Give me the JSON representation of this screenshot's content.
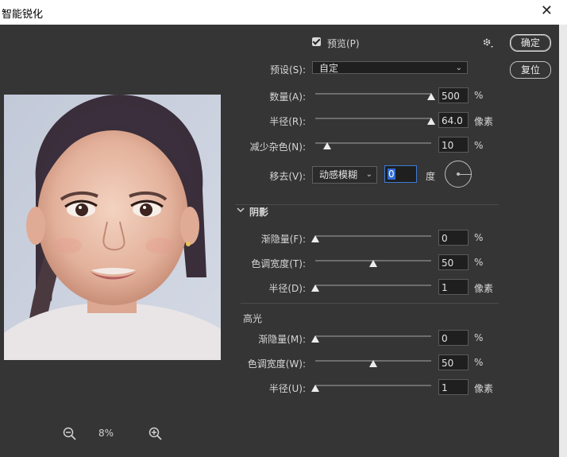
{
  "window": {
    "title": "智能锐化"
  },
  "header": {
    "preview_label": "预览(P)",
    "preview_checked": true
  },
  "buttons": {
    "ok": "确定",
    "reset": "复位"
  },
  "preset": {
    "label": "预设(S):",
    "value": "自定"
  },
  "main": {
    "amount": {
      "label": "数量(A):",
      "value": "500",
      "unit": "%",
      "level": 1.0
    },
    "radius": {
      "label": "半径(R):",
      "value": "64.0",
      "unit": "像素",
      "level": 1.0
    },
    "noise": {
      "label": "减少杂色(N):",
      "value": "10",
      "unit": "%",
      "level": 0.1
    },
    "remove": {
      "label": "移去(V):",
      "value": "动感模糊",
      "angle": "0",
      "angle_unit": "度"
    }
  },
  "shadow": {
    "title": "阴影",
    "fade": {
      "label": "渐隐量(F):",
      "value": "0",
      "unit": "%",
      "level": 0.0
    },
    "tonal_width": {
      "label": "色调宽度(T):",
      "value": "50",
      "unit": "%",
      "level": 0.5
    },
    "radius": {
      "label": "半径(D):",
      "value": "1",
      "unit": "像素",
      "level": 0.0
    }
  },
  "highlight": {
    "title": "高光",
    "fade": {
      "label": "渐隐量(M):",
      "value": "0",
      "unit": "%",
      "level": 0.0
    },
    "tonal_width": {
      "label": "色调宽度(W):",
      "value": "50",
      "unit": "%",
      "level": 0.5
    },
    "radius": {
      "label": "半径(U):",
      "value": "1",
      "unit": "像素",
      "level": 0.0
    }
  },
  "zoom": {
    "value": "8%"
  }
}
